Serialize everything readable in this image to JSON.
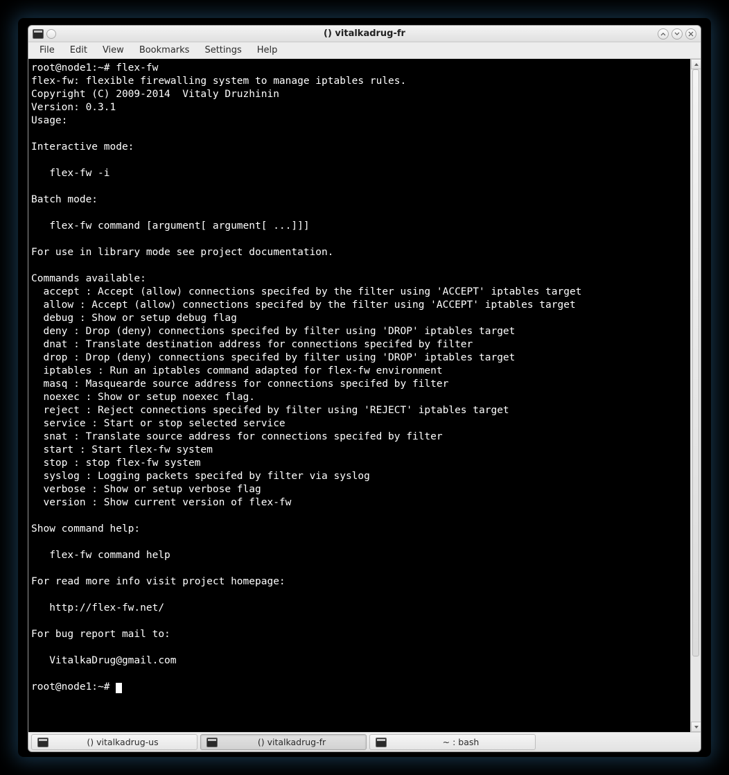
{
  "window": {
    "title": "() vitalkadrug-fr"
  },
  "menu": {
    "file": "File",
    "edit": "Edit",
    "view": "View",
    "bookmarks": "Bookmarks",
    "settings": "Settings",
    "help": "Help"
  },
  "terminal": {
    "prompt1": "root@node1:~# flex-fw",
    "line_desc": "flex-fw: flexible firewalling system to manage iptables rules.",
    "line_copy": "Copyright (C) 2009-2014  Vitaly Druzhinin",
    "line_ver": "Version: 0.3.1",
    "line_usage": "Usage:",
    "line_intmode": "Interactive mode:",
    "line_intcmd": "   flex-fw -i",
    "line_batchmode": "Batch mode:",
    "line_batchcmd": "   flex-fw command [argument[ argument[ ...]]]",
    "line_libmode": "For use in library mode see project documentation.",
    "line_cmds": "Commands available:",
    "cmd_accept": "  accept : Accept (allow) connections specifed by the filter using 'ACCEPT' iptables target",
    "cmd_allow": "  allow : Accept (allow) connections specifed by the filter using 'ACCEPT' iptables target",
    "cmd_debug": "  debug : Show or setup debug flag",
    "cmd_deny": "  deny : Drop (deny) connections specifed by filter using 'DROP' iptables target",
    "cmd_dnat": "  dnat : Translate destination address for connections specifed by filter",
    "cmd_drop": "  drop : Drop (deny) connections specifed by filter using 'DROP' iptables target",
    "cmd_iptables": "  iptables : Run an iptables command adapted for flex-fw environment",
    "cmd_masq": "  masq : Masquearde source address for connections specifed by filter",
    "cmd_noexec": "  noexec : Show or setup noexec flag.",
    "cmd_reject": "  reject : Reject connections specifed by filter using 'REJECT' iptables target",
    "cmd_service": "  service : Start or stop selected service",
    "cmd_snat": "  snat : Translate source address for connections specifed by filter",
    "cmd_start": "  start : Start flex-fw system",
    "cmd_stop": "  stop : stop flex-fw system",
    "cmd_syslog": "  syslog : Logging packets specifed by filter via syslog",
    "cmd_verbose": "  verbose : Show or setup verbose flag",
    "cmd_version": "  version : Show current version of flex-fw",
    "line_showhelp": "Show command help:",
    "line_helpcmd": "   flex-fw command help",
    "line_homepage": "For read more info visit project homepage:",
    "line_url": "   http://flex-fw.net/",
    "line_bugreport": "For bug report mail to:",
    "line_email": "   VitalkaDrug@gmail.com",
    "prompt2": "root@node1:~# "
  },
  "taskbar": {
    "task1": "() vitalkadrug-us",
    "task2": "() vitalkadrug-fr",
    "task3": "~ : bash"
  }
}
